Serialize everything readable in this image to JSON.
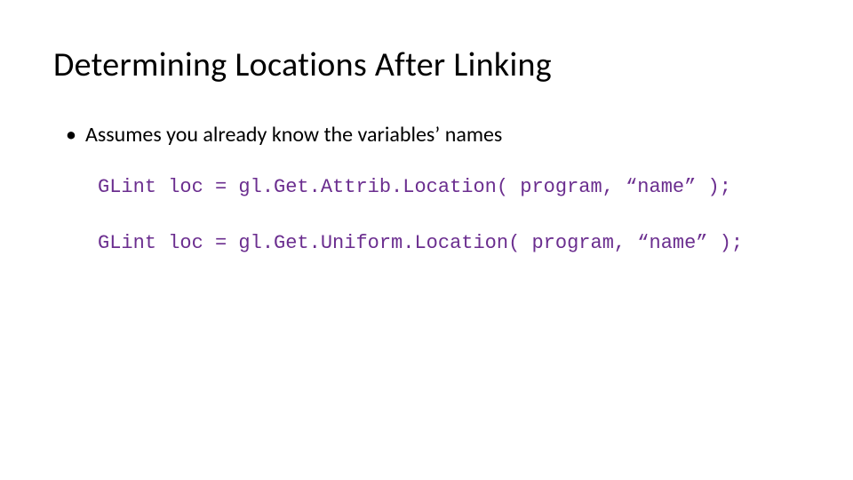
{
  "slide": {
    "title": "Determining Locations After Linking",
    "bullet": "Assumes you already know the variables’ names",
    "code1": "GLint loc = gl.Get.Attrib.Location( program, “name” );",
    "code2": "GLint loc = gl.Get.Uniform.Location( program, “name” );"
  }
}
